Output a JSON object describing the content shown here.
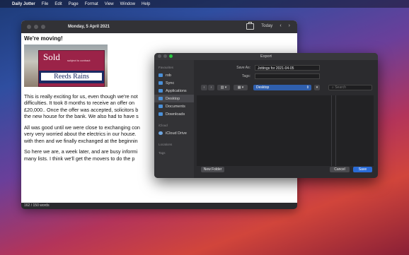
{
  "menubar": {
    "app_name": "Daily Jotter",
    "items": [
      "File",
      "Edit",
      "Page",
      "Format",
      "View",
      "Window",
      "Help"
    ]
  },
  "jotter": {
    "date": "Monday, 5 April 2021",
    "today_label": "Today",
    "prev_icon": "‹",
    "next_icon": "›",
    "heading": "We're moving!",
    "sign_sold": "Sold",
    "sign_subject": "subject to contract",
    "sign_agent": "Reeds Rains",
    "paragraphs": [
      "This is really exciting for us, even though we're not",
      "difficulties. It took 8 months to receive an offer on",
      "£20,000.. Once the offer was accepted, solicitors b",
      "the new house for the bank. We also had to have s",
      "All was good until we were close to exchanging con",
      "very very worried about the electrics in our house.",
      "with then and we finally exchanged at the beginnin",
      "So here we are, a week later, and are busy informi",
      "many lists. I think we'll get the movers to do the p"
    ],
    "word_count": "162 / 150 words"
  },
  "export_dialog": {
    "title": "Export",
    "save_as_label": "Save As:",
    "save_as_value": "Jottings for 2021-04-05",
    "tags_label": "Tags:",
    "tags_value": "",
    "location": "Desktop",
    "search_placeholder": "Search",
    "sidebar": {
      "favourites_header": "Favourites",
      "favourites": [
        "rob",
        "Sync",
        "Applications",
        "Desktop",
        "Documents",
        "Downloads"
      ],
      "icloud_header": "iCloud",
      "icloud": [
        "iCloud Drive"
      ],
      "locations_header": "Locations",
      "tags_header": "Tags"
    },
    "new_folder_label": "New Folder",
    "cancel_label": "Cancel",
    "save_label": "Save"
  }
}
